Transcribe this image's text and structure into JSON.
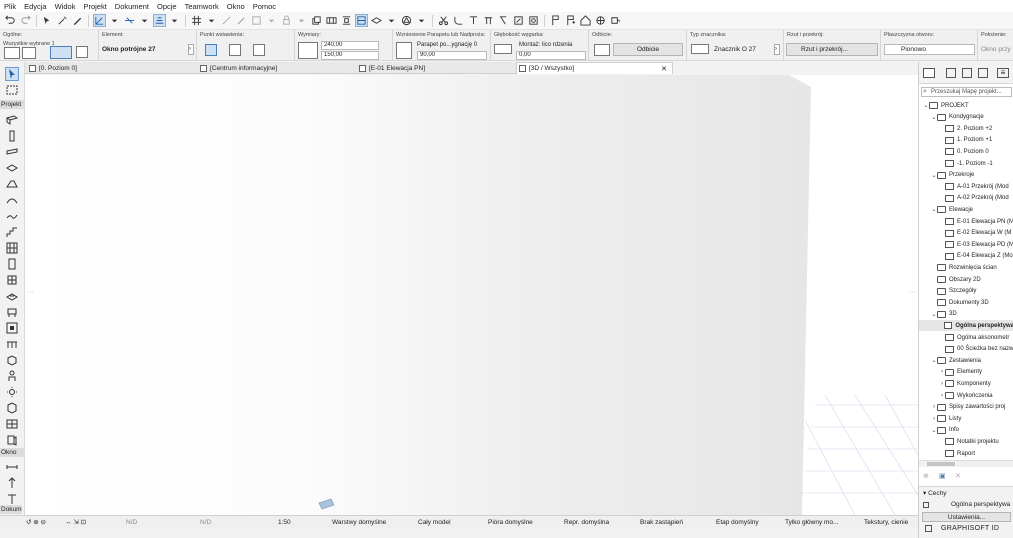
{
  "menu": [
    "Plik",
    "Edycja",
    "Widok",
    "Projekt",
    "Dokument",
    "Opcje",
    "Teamwork",
    "Okno",
    "Pomoc"
  ],
  "infobox": {
    "ogolne_label": "Ogólne:",
    "wszystkie_wybrane": "Wszystkie wybrane 1",
    "element_label": "Element:",
    "element_value": "Okno potrójne 27",
    "punkt_label": "Punkt wstawienia:",
    "wymiary_label": "Wymiary:",
    "dim_width": "240,00",
    "dim_height": "150,00",
    "wzniesienie_label": "Wzniesienie Parapetu lub Nadproża:",
    "parapet_value": "Parapet po...ygnację 0",
    "parapet_height": "90,00",
    "glebokosc_label": "Głębokość węgarka:",
    "montaz_value": "Montaż: lico rdzenia",
    "montaz_depth": "0,00",
    "odbicie_label": "Odbicie:",
    "odbicie_button": "Odbicie",
    "typ_label": "Typ znacznika:",
    "typ_value": "Znacznik O 27",
    "rzut_label": "Rzut i przekrój:",
    "rzut_value": "Rzut i przekrój...",
    "plaszczyzna_label": "Płaszczyzna otworu:",
    "plaszczyzna_value": "Pionowo",
    "polozenie_label": "Położenie:",
    "polozenie_value": "Okno przy"
  },
  "tabs": [
    "[0. Poziom 0]",
    "[Centrum informacyjne]",
    "[E-01 Elewacja PN]",
    "[3D / Wszystko]"
  ],
  "toolbox": {
    "projekt": "Projekt",
    "okno": "Okno",
    "dokument": "Dokume"
  },
  "statusbar": {
    "nd1": "N/D",
    "nd2": "N/D",
    "scale": "1:50",
    "warstwy": "Warstwy domyślne",
    "model": "Cały model",
    "piora": "Pióra domyślne",
    "repr": "Repr. domyślna",
    "brak": "Brak zastąpień",
    "etap": "Etap domyślny",
    "tylko": "Tylko główny mo...",
    "tekstury": "Tekstury, cienie"
  },
  "navigator": {
    "search_placeholder": "Przeszukaj Mapę projekt...",
    "tree": [
      {
        "label": "PROJEKT",
        "indent": 0,
        "tog": "⌄",
        "icon": "folder"
      },
      {
        "label": "Kondygnacje",
        "indent": 1,
        "tog": "⌄",
        "icon": "folder"
      },
      {
        "label": "2. Poziom +2",
        "indent": 2,
        "tog": "",
        "icon": "story"
      },
      {
        "label": "1. Poziom +1",
        "indent": 2,
        "tog": "",
        "icon": "story"
      },
      {
        "label": "0. Poziom 0",
        "indent": 2,
        "tog": "",
        "icon": "story"
      },
      {
        "label": "-1. Poziom -1",
        "indent": 2,
        "tog": "",
        "icon": "story"
      },
      {
        "label": "Przekroje",
        "indent": 1,
        "tog": "⌄",
        "icon": "folder"
      },
      {
        "label": "A-01 Przekrój (Mod",
        "indent": 2,
        "tog": "",
        "icon": "section"
      },
      {
        "label": "A-02 Przekrój (Mod",
        "indent": 2,
        "tog": "",
        "icon": "section"
      },
      {
        "label": "Elewacje",
        "indent": 1,
        "tog": "⌄",
        "icon": "folder"
      },
      {
        "label": "E-01 Elewacja PN (M",
        "indent": 2,
        "tog": "",
        "icon": "elev"
      },
      {
        "label": "E-02 Elewacja W (M",
        "indent": 2,
        "tog": "",
        "icon": "elev"
      },
      {
        "label": "E-03 Elewacja PD (M",
        "indent": 2,
        "tog": "",
        "icon": "elev"
      },
      {
        "label": "E-04 Elewacja Z (Mo",
        "indent": 2,
        "tog": "",
        "icon": "elev"
      },
      {
        "label": "Rozwinięcia ścian",
        "indent": 1,
        "tog": "",
        "icon": "folder"
      },
      {
        "label": "Obszary 2D",
        "indent": 1,
        "tog": "",
        "icon": "folder"
      },
      {
        "label": "Szczegóły",
        "indent": 1,
        "tog": "",
        "icon": "folder"
      },
      {
        "label": "Dokumenty 3D",
        "indent": 1,
        "tog": "",
        "icon": "folder"
      },
      {
        "label": "3D",
        "indent": 1,
        "tog": "⌄",
        "icon": "folder"
      },
      {
        "label": "Ogólna perspektywa",
        "indent": 2,
        "tog": "",
        "icon": "view",
        "selected": true
      },
      {
        "label": "Ogólna aksonometr",
        "indent": 2,
        "tog": "",
        "icon": "view"
      },
      {
        "label": "00 Ścieżka bez nazw",
        "indent": 2,
        "tog": "",
        "icon": "view"
      },
      {
        "label": "Zestawienia",
        "indent": 1,
        "tog": "⌄",
        "icon": "folder"
      },
      {
        "label": "Elementy",
        "indent": 2,
        "tog": "›",
        "icon": "folder"
      },
      {
        "label": "Komponenty",
        "indent": 2,
        "tog": "›",
        "icon": "folder"
      },
      {
        "label": "Wykończenia",
        "indent": 2,
        "tog": "›",
        "icon": "folder"
      },
      {
        "label": "Spisy zawartości proj",
        "indent": 1,
        "tog": "›",
        "icon": "folder"
      },
      {
        "label": "Listy",
        "indent": 1,
        "tog": "›",
        "icon": "folder"
      },
      {
        "label": "Info",
        "indent": 1,
        "tog": "⌄",
        "icon": "folder"
      },
      {
        "label": "Notatki projektu",
        "indent": 2,
        "tog": "",
        "icon": "doc"
      },
      {
        "label": "Raport",
        "indent": 2,
        "tog": "",
        "icon": "doc"
      }
    ],
    "cechy": "Cechy",
    "selected_view": "Ogólna perspektywa",
    "ustawienia": "Ustawienia...",
    "brand": "GRAPHISOFT ID"
  }
}
